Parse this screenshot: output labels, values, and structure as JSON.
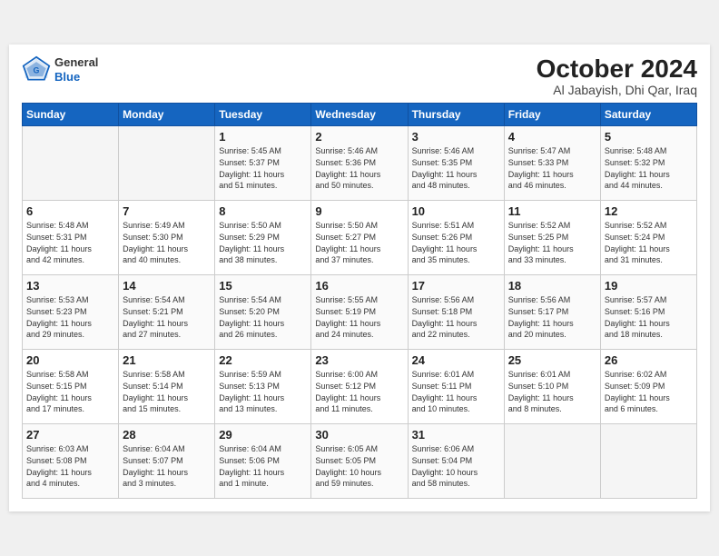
{
  "logo": {
    "general": "General",
    "blue": "Blue"
  },
  "title": "October 2024",
  "subtitle": "Al Jabayish, Dhi Qar, Iraq",
  "days_of_week": [
    "Sunday",
    "Monday",
    "Tuesday",
    "Wednesday",
    "Thursday",
    "Friday",
    "Saturday"
  ],
  "weeks": [
    [
      {
        "num": "",
        "info": ""
      },
      {
        "num": "",
        "info": ""
      },
      {
        "num": "1",
        "info": "Sunrise: 5:45 AM\nSunset: 5:37 PM\nDaylight: 11 hours\nand 51 minutes."
      },
      {
        "num": "2",
        "info": "Sunrise: 5:46 AM\nSunset: 5:36 PM\nDaylight: 11 hours\nand 50 minutes."
      },
      {
        "num": "3",
        "info": "Sunrise: 5:46 AM\nSunset: 5:35 PM\nDaylight: 11 hours\nand 48 minutes."
      },
      {
        "num": "4",
        "info": "Sunrise: 5:47 AM\nSunset: 5:33 PM\nDaylight: 11 hours\nand 46 minutes."
      },
      {
        "num": "5",
        "info": "Sunrise: 5:48 AM\nSunset: 5:32 PM\nDaylight: 11 hours\nand 44 minutes."
      }
    ],
    [
      {
        "num": "6",
        "info": "Sunrise: 5:48 AM\nSunset: 5:31 PM\nDaylight: 11 hours\nand 42 minutes."
      },
      {
        "num": "7",
        "info": "Sunrise: 5:49 AM\nSunset: 5:30 PM\nDaylight: 11 hours\nand 40 minutes."
      },
      {
        "num": "8",
        "info": "Sunrise: 5:50 AM\nSunset: 5:29 PM\nDaylight: 11 hours\nand 38 minutes."
      },
      {
        "num": "9",
        "info": "Sunrise: 5:50 AM\nSunset: 5:27 PM\nDaylight: 11 hours\nand 37 minutes."
      },
      {
        "num": "10",
        "info": "Sunrise: 5:51 AM\nSunset: 5:26 PM\nDaylight: 11 hours\nand 35 minutes."
      },
      {
        "num": "11",
        "info": "Sunrise: 5:52 AM\nSunset: 5:25 PM\nDaylight: 11 hours\nand 33 minutes."
      },
      {
        "num": "12",
        "info": "Sunrise: 5:52 AM\nSunset: 5:24 PM\nDaylight: 11 hours\nand 31 minutes."
      }
    ],
    [
      {
        "num": "13",
        "info": "Sunrise: 5:53 AM\nSunset: 5:23 PM\nDaylight: 11 hours\nand 29 minutes."
      },
      {
        "num": "14",
        "info": "Sunrise: 5:54 AM\nSunset: 5:21 PM\nDaylight: 11 hours\nand 27 minutes."
      },
      {
        "num": "15",
        "info": "Sunrise: 5:54 AM\nSunset: 5:20 PM\nDaylight: 11 hours\nand 26 minutes."
      },
      {
        "num": "16",
        "info": "Sunrise: 5:55 AM\nSunset: 5:19 PM\nDaylight: 11 hours\nand 24 minutes."
      },
      {
        "num": "17",
        "info": "Sunrise: 5:56 AM\nSunset: 5:18 PM\nDaylight: 11 hours\nand 22 minutes."
      },
      {
        "num": "18",
        "info": "Sunrise: 5:56 AM\nSunset: 5:17 PM\nDaylight: 11 hours\nand 20 minutes."
      },
      {
        "num": "19",
        "info": "Sunrise: 5:57 AM\nSunset: 5:16 PM\nDaylight: 11 hours\nand 18 minutes."
      }
    ],
    [
      {
        "num": "20",
        "info": "Sunrise: 5:58 AM\nSunset: 5:15 PM\nDaylight: 11 hours\nand 17 minutes."
      },
      {
        "num": "21",
        "info": "Sunrise: 5:58 AM\nSunset: 5:14 PM\nDaylight: 11 hours\nand 15 minutes."
      },
      {
        "num": "22",
        "info": "Sunrise: 5:59 AM\nSunset: 5:13 PM\nDaylight: 11 hours\nand 13 minutes."
      },
      {
        "num": "23",
        "info": "Sunrise: 6:00 AM\nSunset: 5:12 PM\nDaylight: 11 hours\nand 11 minutes."
      },
      {
        "num": "24",
        "info": "Sunrise: 6:01 AM\nSunset: 5:11 PM\nDaylight: 11 hours\nand 10 minutes."
      },
      {
        "num": "25",
        "info": "Sunrise: 6:01 AM\nSunset: 5:10 PM\nDaylight: 11 hours\nand 8 minutes."
      },
      {
        "num": "26",
        "info": "Sunrise: 6:02 AM\nSunset: 5:09 PM\nDaylight: 11 hours\nand 6 minutes."
      }
    ],
    [
      {
        "num": "27",
        "info": "Sunrise: 6:03 AM\nSunset: 5:08 PM\nDaylight: 11 hours\nand 4 minutes."
      },
      {
        "num": "28",
        "info": "Sunrise: 6:04 AM\nSunset: 5:07 PM\nDaylight: 11 hours\nand 3 minutes."
      },
      {
        "num": "29",
        "info": "Sunrise: 6:04 AM\nSunset: 5:06 PM\nDaylight: 11 hours\nand 1 minute."
      },
      {
        "num": "30",
        "info": "Sunrise: 6:05 AM\nSunset: 5:05 PM\nDaylight: 10 hours\nand 59 minutes."
      },
      {
        "num": "31",
        "info": "Sunrise: 6:06 AM\nSunset: 5:04 PM\nDaylight: 10 hours\nand 58 minutes."
      },
      {
        "num": "",
        "info": ""
      },
      {
        "num": "",
        "info": ""
      }
    ]
  ]
}
